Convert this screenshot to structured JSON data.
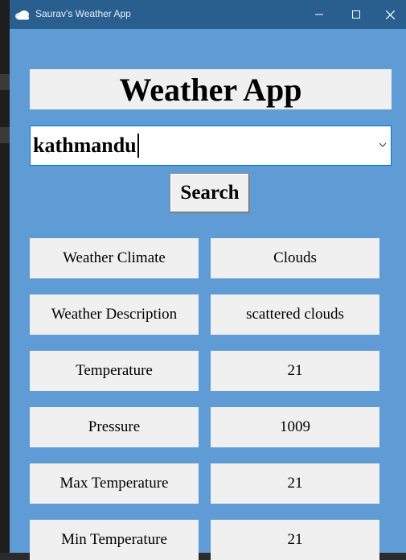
{
  "window": {
    "title": "Saurav's Weather App",
    "icon": "cloud-icon",
    "controls": {
      "minimize": "minimize-icon",
      "maximize": "maximize-icon",
      "close": "close-icon"
    },
    "colors": {
      "titlebar": "#285f8f",
      "client_bg": "#5f9bd5",
      "panel_bg": "#f0f0f0"
    }
  },
  "app": {
    "heading": "Weather App",
    "city_input": {
      "value": "kathmandu"
    },
    "search_label": "Search",
    "rows": [
      {
        "label": "Weather Climate",
        "value": "Clouds"
      },
      {
        "label": "Weather Description",
        "value": "scattered clouds"
      },
      {
        "label": "Temperature",
        "value": "21"
      },
      {
        "label": "Pressure",
        "value": "1009"
      },
      {
        "label": "Max Temperature",
        "value": "21"
      },
      {
        "label": "Min Temperature",
        "value": "21"
      }
    ]
  }
}
